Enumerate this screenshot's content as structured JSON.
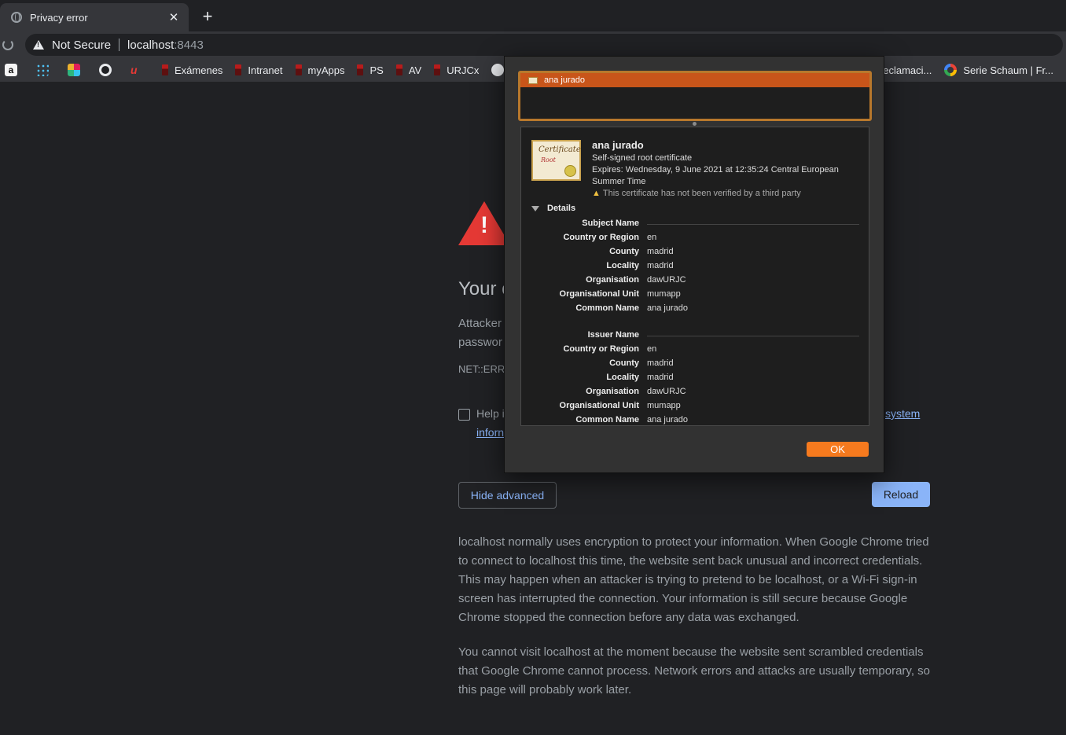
{
  "tab": {
    "title": "Privacy error",
    "close": "✕",
    "new_tab": "+"
  },
  "omnibox": {
    "security_label": "Not Secure",
    "host": "localhost",
    "port": ":8443"
  },
  "bookmarks": [
    {
      "label": "",
      "icon": "amazon-icon",
      "glyph": "a"
    },
    {
      "label": "",
      "icon": "dots-app-icon"
    },
    {
      "label": "",
      "icon": "slack-icon"
    },
    {
      "label": "",
      "icon": "whatsapp-icon"
    },
    {
      "label": "",
      "icon": "u-app-icon",
      "glyph": "u"
    },
    {
      "label": "Exámenes",
      "icon": "urjc-icon"
    },
    {
      "label": "Intranet",
      "icon": "urjc-icon"
    },
    {
      "label": "myApps",
      "icon": "urjc-icon"
    },
    {
      "label": "PS",
      "icon": "urjc-icon"
    },
    {
      "label": "AV",
      "icon": "urjc-icon"
    },
    {
      "label": "URJCx",
      "icon": "urjc-icon"
    },
    {
      "label": "",
      "icon": "github-icon"
    },
    {
      "label": "Reclamaci...",
      "icon": "none"
    },
    {
      "label": "Serie Schaum | Fr...",
      "icon": "google-icon"
    }
  ],
  "page": {
    "heading": "Your c",
    "intro_line1": "Attacker",
    "intro_line2": "passwor",
    "error_code": "NET::ERR",
    "help_text": "Help i",
    "help_link": "inforn",
    "help_link2": "system",
    "hide_advanced": "Hide advanced",
    "reload": "Reload",
    "para1": "localhost normally uses encryption to protect your information. When Google Chrome tried to connect to localhost this time, the website sent back unusual and incorrect credentials. This may happen when an attacker is trying to pretend to be localhost, or a Wi-Fi sign-in screen has interrupted the connection. Your information is still secure because Google Chrome stopped the connection before any data was exchanged.",
    "para2": "You cannot visit localhost at the moment because the website sent scrambled credentials that Google Chrome cannot process. Network errors and attacks are usually temporary, so this page will probably work later."
  },
  "dialog": {
    "list_item": "ana jurado",
    "cert_image_text1": "Certificate",
    "cert_image_text2": "Root",
    "cert_name": "ana jurado",
    "cert_type": "Self-signed root certificate",
    "expires": "Expires: Wednesday, 9 June 2021 at 12:35:24 Central European Summer Time",
    "warning": "This certificate has not been verified by a third party",
    "details_label": "Details",
    "subject_title": "Subject Name",
    "subject": [
      {
        "k": "Country or Region",
        "v": "en"
      },
      {
        "k": "County",
        "v": "madrid"
      },
      {
        "k": "Locality",
        "v": "madrid"
      },
      {
        "k": "Organisation",
        "v": "dawURJC"
      },
      {
        "k": "Organisational Unit",
        "v": "mumapp"
      },
      {
        "k": "Common Name",
        "v": "ana jurado"
      }
    ],
    "issuer_title": "Issuer Name",
    "issuer": [
      {
        "k": "Country or Region",
        "v": "en"
      },
      {
        "k": "County",
        "v": "madrid"
      },
      {
        "k": "Locality",
        "v": "madrid"
      },
      {
        "k": "Organisation",
        "v": "dawURJC"
      },
      {
        "k": "Organisational Unit",
        "v": "mumapp"
      },
      {
        "k": "Common Name",
        "v": "ana jurado"
      }
    ],
    "ok": "OK"
  },
  "colors": {
    "accent": "#8ab4f8",
    "danger": "#e53935",
    "dialog_highlight": "#c8551a",
    "ok_button": "#f67a1e"
  }
}
